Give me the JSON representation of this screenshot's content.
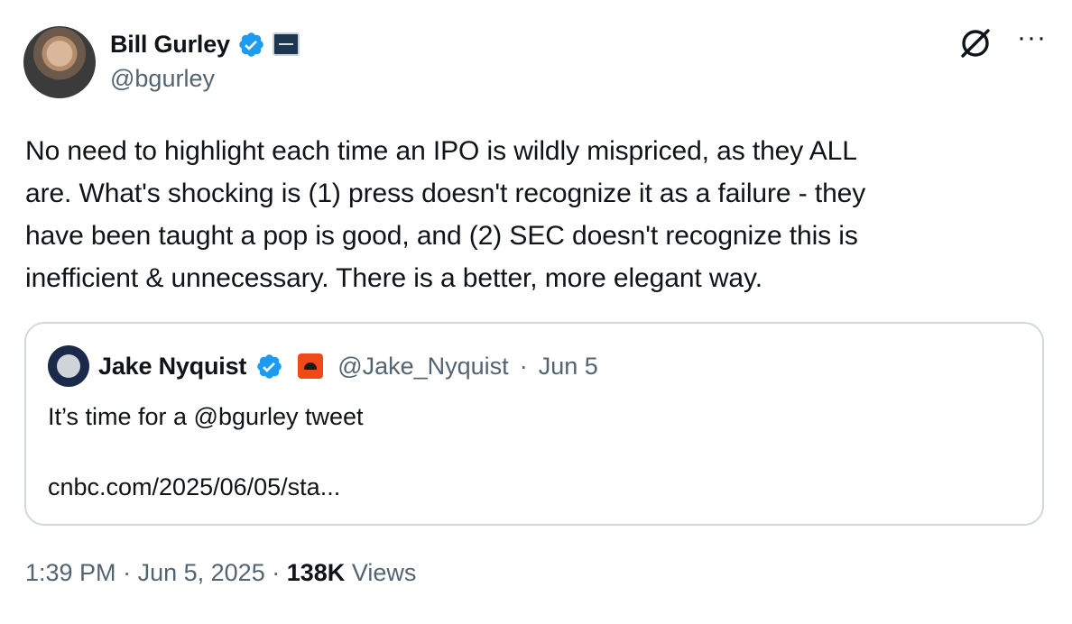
{
  "author": {
    "name": "Bill Gurley",
    "handle": "@bgurley"
  },
  "tweet": {
    "text": "No need to highlight each time an IPO is wildly mispriced, as they ALL\nare. What's shocking is (1) press doesn't recognize it as a failure - they\nhave been taught a pop is good, and (2) SEC doesn't recognize this is\ninefficient & unnecessary. There is a better, more elegant way."
  },
  "quote": {
    "name": "Jake Nyquist",
    "handle": "@Jake_Nyquist",
    "separator": "·",
    "date": "Jun 5",
    "text": "It’s time for a @bgurley tweet",
    "link": "cnbc.com/2025/06/05/sta..."
  },
  "footer": {
    "time": "1:39 PM",
    "sep1": "·",
    "date": "Jun 5, 2025",
    "sep2": "·",
    "views_count": "138K",
    "views_label": "Views"
  },
  "colors": {
    "verified": "#1d9bf0",
    "secondary_text": "#536471",
    "border": "#cfd9de"
  },
  "icons": [
    "verified-badge-icon",
    "affiliation-badge-icon",
    "grok-icon",
    "more-icon"
  ]
}
